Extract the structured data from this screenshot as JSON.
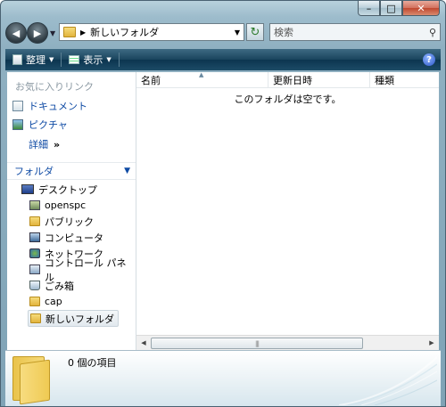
{
  "window": {
    "caption_buttons": {
      "minimize": "–",
      "maximize": "□",
      "close": "✕"
    }
  },
  "nav": {
    "back_glyph": "◀",
    "forward_glyph": "▶",
    "address_separator": "▶",
    "address_path": "新しいフォルダ",
    "search_placeholder": "検索"
  },
  "toolbar": {
    "organize_label": "整理",
    "views_label": "表示",
    "help_glyph": "?"
  },
  "sidebar": {
    "favorites_header": "お気に入りリンク",
    "favorites": [
      {
        "label": "ドキュメント",
        "icon": "documents-icon"
      },
      {
        "label": "ピクチャ",
        "icon": "pictures-icon"
      }
    ],
    "more_label": "詳細",
    "more_glyph": "»",
    "folders_header": "フォルダ",
    "folders_toggle": "⌄",
    "tree": [
      {
        "label": "デスクトップ",
        "icon": "desktop-icon"
      },
      {
        "label": "openspc",
        "icon": "user-folder-icon"
      },
      {
        "label": "パブリック",
        "icon": "folder-icon"
      },
      {
        "label": "コンピュータ",
        "icon": "computer-icon"
      },
      {
        "label": "ネットワーク",
        "icon": "network-icon"
      },
      {
        "label": "コントロール パネル",
        "icon": "control-panel-icon"
      },
      {
        "label": "ごみ箱",
        "icon": "recycle-bin-icon"
      },
      {
        "label": "cap",
        "icon": "folder-icon"
      },
      {
        "label": "新しいフォルダ",
        "icon": "folder-icon",
        "selected": true
      }
    ]
  },
  "content": {
    "columns": [
      "名前",
      "更新日時",
      "種類"
    ],
    "empty_message": "このフォルダは空です。"
  },
  "details": {
    "item_count": "0 個の項目"
  }
}
